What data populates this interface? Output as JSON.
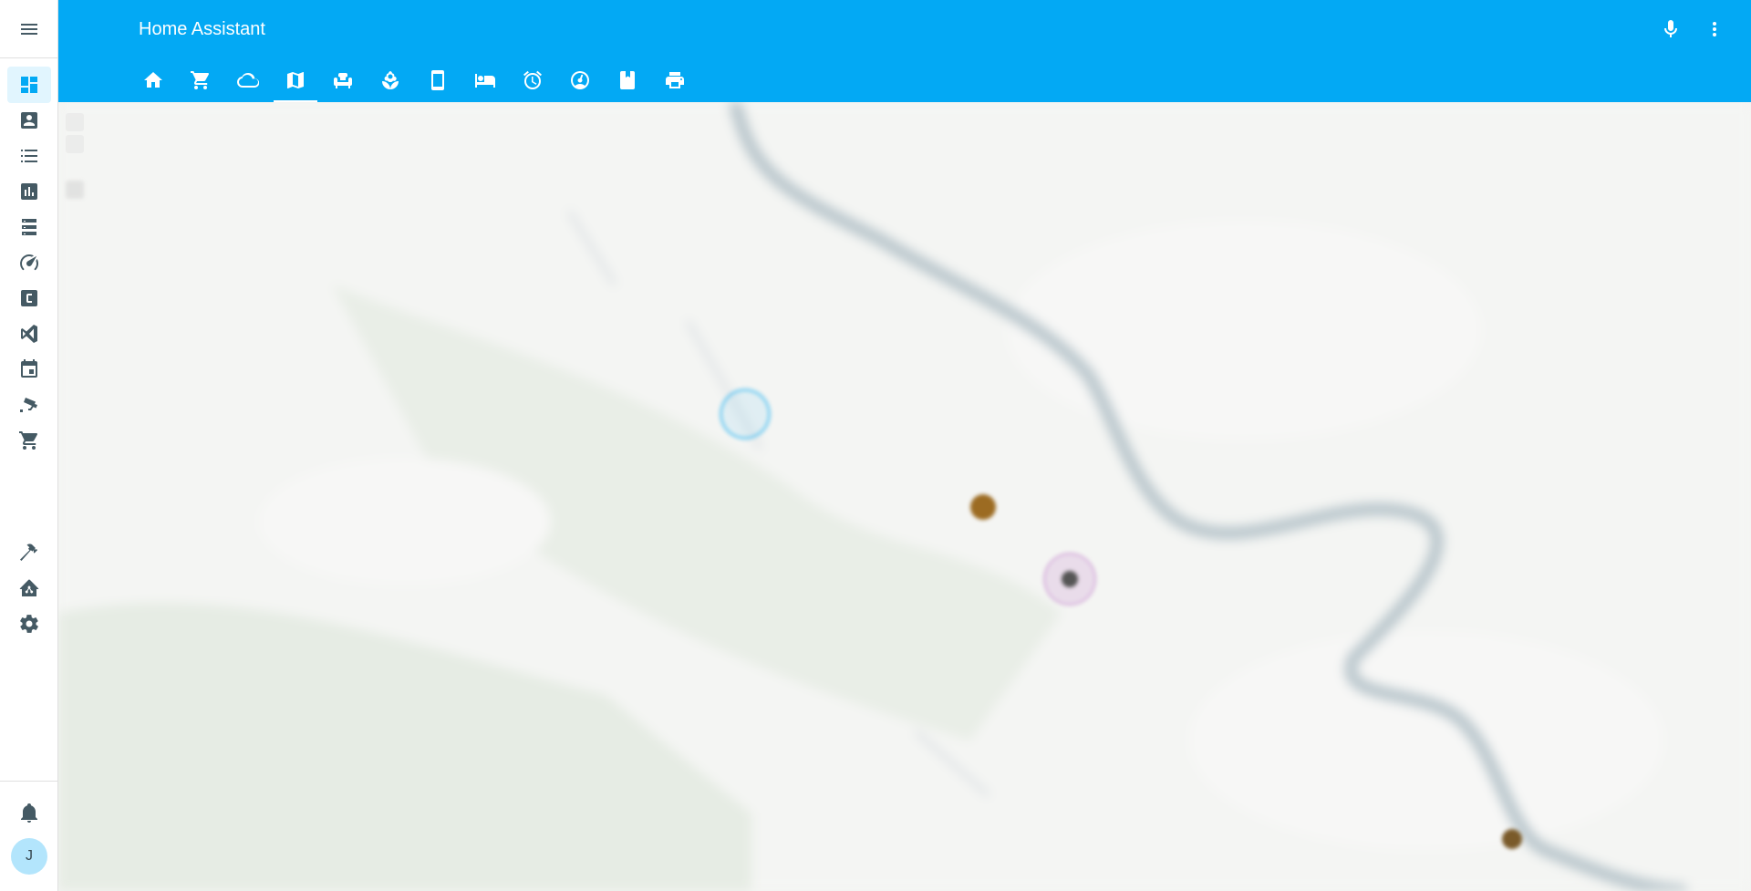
{
  "app": {
    "title": "Home Assistant"
  },
  "sidebar": {
    "menu_icon": "menu-icon",
    "items": [
      {
        "icon": "dashboard-icon",
        "active": true
      },
      {
        "icon": "account-box-icon",
        "active": false
      },
      {
        "icon": "format-list-bulleted-icon",
        "active": false
      },
      {
        "icon": "chart-box-icon",
        "active": false
      },
      {
        "icon": "server-icon",
        "active": false
      },
      {
        "icon": "speedometer-icon",
        "active": false
      },
      {
        "icon": "alpha-c-box-icon",
        "active": false
      },
      {
        "icon": "vscode-icon",
        "active": false
      },
      {
        "icon": "calendar-icon",
        "active": false
      },
      {
        "icon": "cctv-icon",
        "active": false
      },
      {
        "icon": "cart-icon",
        "active": false
      }
    ],
    "bottom_items": [
      {
        "icon": "hammer-icon"
      },
      {
        "icon": "home-assistant-icon"
      },
      {
        "icon": "cog-icon"
      }
    ],
    "notifications_icon": "bell-icon",
    "user_initial": "J"
  },
  "header": {
    "mic_icon": "microphone-icon",
    "more_icon": "dots-vertical-icon",
    "tabs": [
      {
        "icon": "home-icon",
        "active": false
      },
      {
        "icon": "cart-icon",
        "active": false
      },
      {
        "icon": "cloud-outline-icon",
        "active": false
      },
      {
        "icon": "map-icon",
        "active": true
      },
      {
        "icon": "sofa-icon",
        "active": false
      },
      {
        "icon": "flower-icon",
        "active": false
      },
      {
        "icon": "cellphone-icon",
        "active": false
      },
      {
        "icon": "bed-icon",
        "active": false
      },
      {
        "icon": "alarm-icon",
        "active": false
      },
      {
        "icon": "gauge-icon",
        "active": false
      },
      {
        "icon": "book-icon",
        "active": false
      },
      {
        "icon": "printer-icon",
        "active": false
      }
    ]
  },
  "map": {
    "colors": {
      "river": "#b9c6cc",
      "land": "#f4f5f3",
      "green": "#e6ece4"
    }
  }
}
